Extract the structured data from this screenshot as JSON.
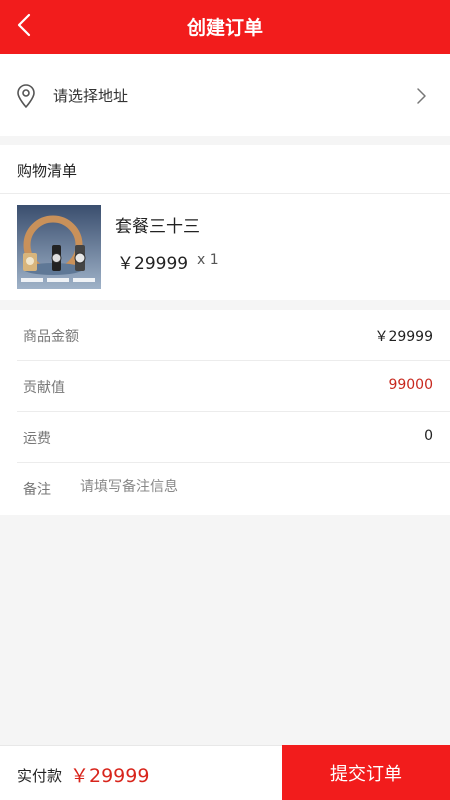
{
  "header": {
    "title": "创建订单",
    "back_icon": "chevron-left-icon"
  },
  "address": {
    "placeholder": "请选择地址",
    "icon": "location-pin-icon",
    "arrow_icon": "chevron-right-icon"
  },
  "cart": {
    "heading": "购物清单",
    "item": {
      "name": "套餐三十三",
      "price": "￥29999",
      "quantity": "x 1"
    }
  },
  "summary": {
    "rows": [
      {
        "label": "商品金额",
        "value": "￥29999"
      },
      {
        "label": "贡献值",
        "value": "99000"
      },
      {
        "label": "运费",
        "value": "0"
      }
    ],
    "note": {
      "label": "备注",
      "placeholder": "请填写备注信息"
    }
  },
  "footer": {
    "label": "实付款",
    "total": "￥29999",
    "submit": "提交订单"
  },
  "colors": {
    "brand_red": "#f21c1c",
    "price_red": "#d8251c"
  }
}
